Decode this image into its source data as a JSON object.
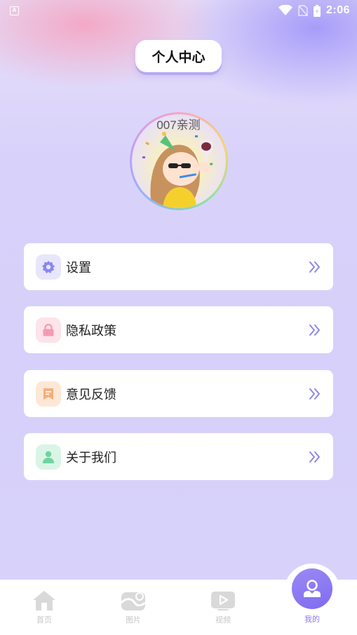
{
  "status_bar": {
    "time": "2:06",
    "left_icon": "a-notification-icon",
    "right_icons": [
      "wifi-icon",
      "no-sim-icon",
      "battery-charging-icon"
    ]
  },
  "header": {
    "title": "个人中心"
  },
  "profile": {
    "nickname": "007亲测",
    "avatar": "cartoon-girl-avatar"
  },
  "menu": {
    "items": [
      {
        "label": "设置",
        "icon": "gear-icon",
        "icon_bg": "#e8e6fb",
        "icon_color": "#8a86f0"
      },
      {
        "label": "隐私政策",
        "icon": "lock-icon",
        "icon_bg": "#fde3ea",
        "icon_color": "#f59ab3"
      },
      {
        "label": "意见反馈",
        "icon": "feedback-icon",
        "icon_bg": "#fde7d6",
        "icon_color": "#f6ae7a"
      },
      {
        "label": "关于我们",
        "icon": "person-icon",
        "icon_bg": "#d9f5e6",
        "icon_color": "#6fd3a0"
      }
    ],
    "arrow_color": "#8d86e8"
  },
  "tabbar": {
    "tabs": [
      {
        "label": "首页",
        "icon": "home-icon",
        "active": false
      },
      {
        "label": "图片",
        "icon": "image-icon",
        "active": false
      },
      {
        "label": "视频",
        "icon": "video-icon",
        "active": false
      },
      {
        "label": "我的",
        "icon": "profile-icon",
        "active": true
      }
    ],
    "accent": "#8a79f2"
  }
}
